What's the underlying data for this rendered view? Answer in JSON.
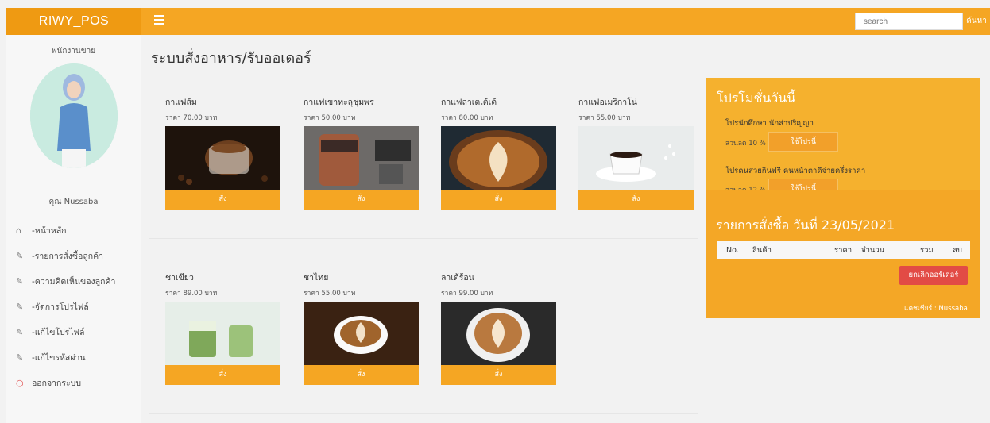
{
  "topbar": {
    "brand": "RIWY_POS",
    "search_placeholder": "search",
    "search_button": "ค้นหา"
  },
  "sidebar": {
    "role": "พนักงานขาย",
    "user": "คุณ Nussaba",
    "items": [
      {
        "icon": "home-icon",
        "label": "-หน้าหลัก"
      },
      {
        "icon": "edit-icon",
        "label": "-รายการสั่งซื้อลูกค้า"
      },
      {
        "icon": "edit-icon",
        "label": "-ความคิดเห็นของลูกค้า"
      },
      {
        "icon": "edit-icon",
        "label": "-จัดการโปรไฟล์"
      },
      {
        "icon": "edit-icon",
        "label": "-แก้ไขโปรไฟล์"
      },
      {
        "icon": "edit-icon",
        "label": "-แก้ไขรหัสผ่าน"
      },
      {
        "icon": "logout-icon",
        "label": "ออกจากระบบ"
      }
    ]
  },
  "main": {
    "title": "ระบบสั่งอาหาร/รับออเดอร์",
    "products": [
      {
        "name": "กาแฟส้ม",
        "price": "ราคา 70.00 บาท",
        "button": "สั่ง"
      },
      {
        "name": "กาแฟเขาทะลุชุมพร",
        "price": "ราคา 50.00 บาท",
        "button": "สั่ง"
      },
      {
        "name": "กาแฟลาเตเต้เต้",
        "price": "ราคา 80.00 บาท",
        "button": "สั่ง"
      },
      {
        "name": "กาแฟอเมริกาโน่",
        "price": "ราคา 55.00 บาท",
        "button": "สั่ง"
      },
      {
        "name": "ชาเขียว",
        "price": "ราคา 89.00 บาท",
        "button": "สั่ง"
      },
      {
        "name": "ชาไทย",
        "price": "ราคา 55.00 บาท",
        "button": "สั่ง"
      },
      {
        "name": "ลาเต้ร้อน",
        "price": "ราคา 99.00 บาท",
        "button": "สั่ง"
      }
    ]
  },
  "promo": {
    "title": "โปรโมชั่นวันนี้",
    "items": [
      {
        "name": "โปรนักศึกษา นักล่าปริญญา",
        "discount": "ส่วนลด 10 %",
        "button": "ใช้โปรนี้"
      },
      {
        "name": "โปรคนสวยกินฟรี คนหน้าตาดีจ่ายครึ่งราคา",
        "discount": "ส่วนลด 12 %",
        "button": "ใช้โปรนี้"
      }
    ]
  },
  "order": {
    "title": "รายการสั่งซื้อ วันที่ 23/05/2021",
    "columns": [
      "No.",
      "สินค้า",
      "ราคา",
      "จำนวน",
      "รวม",
      "ลบ"
    ],
    "cancel_button": "ยกเลิกออร์เดอร์",
    "cashier": "แคชเชียร์ : Nussaba"
  },
  "colors": {
    "accent": "#f5a623",
    "brand_bg": "#ef9a12",
    "danger": "#e24b45"
  }
}
